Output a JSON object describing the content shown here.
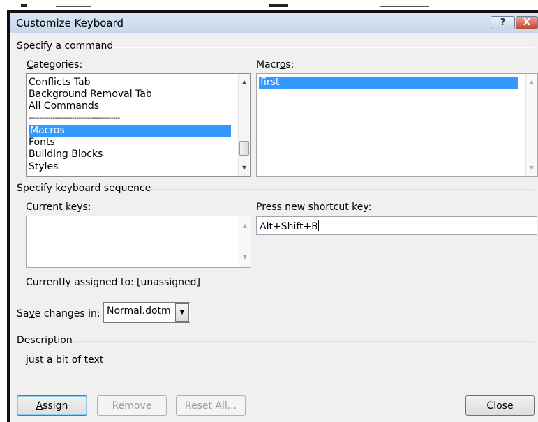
{
  "window": {
    "title": "Customize Keyboard",
    "help_label": "?",
    "close_label": "X"
  },
  "command_section": {
    "heading": "Specify a command",
    "categories_label": "Categories:",
    "categories": [
      "Conflicts Tab",
      "Background Removal Tab",
      "All Commands",
      "------------------------------------------",
      "Macros",
      "Fonts",
      "Building Blocks",
      "Styles"
    ],
    "selected_category": "Macros",
    "macros_label": "Macros:",
    "macros": [
      "first"
    ],
    "selected_macro": "first"
  },
  "keyboard_section": {
    "heading": "Specify keyboard sequence",
    "current_keys_label": "Current keys:",
    "new_shortcut_label": "Press new shortcut key:",
    "new_shortcut_value": "Alt+Shift+B",
    "assigned_label": "Currently assigned to:",
    "assigned_value": "[unassigned]"
  },
  "save": {
    "label": "Save changes in:",
    "value": "Normal.dotm"
  },
  "description": {
    "heading": "Description",
    "text": "just a bit of text"
  },
  "buttons": {
    "assign": "Assign",
    "remove": "Remove",
    "reset_all": "Reset All...",
    "close": "Close"
  },
  "colors": {
    "selection": "#3399ff",
    "dialog_bg": "#f0f0f0",
    "titlebar": "#c7d8ec"
  }
}
